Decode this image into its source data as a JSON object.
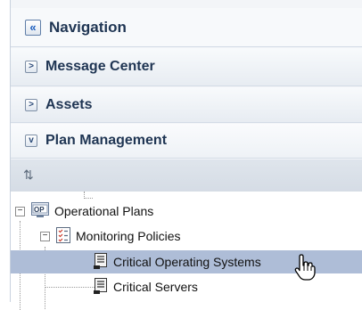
{
  "navigation": {
    "title": "Navigation"
  },
  "sections": [
    {
      "label": "Message Center",
      "state": "collapsed"
    },
    {
      "label": "Assets",
      "state": "collapsed"
    },
    {
      "label": "Plan Management",
      "state": "expanded"
    }
  ],
  "tree": {
    "items": [
      {
        "label": "Operational Plans",
        "icon": "operational-plans-icon"
      },
      {
        "label": "Monitoring Policies",
        "icon": "policy-folder-icon"
      },
      {
        "label": "Critical Operating Systems",
        "icon": "policy-icon",
        "selected": true
      },
      {
        "label": "Critical Servers",
        "icon": "policy-icon"
      }
    ]
  },
  "colors": {
    "selection": "#aebdd7",
    "header_text": "#1f3553"
  }
}
